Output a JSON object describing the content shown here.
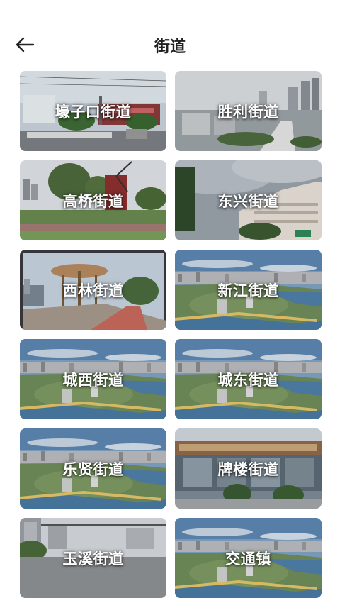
{
  "header": {
    "title": "街道",
    "back_icon": "back-arrow-icon"
  },
  "cards": [
    {
      "label": "壕子口街道",
      "scene": "street"
    },
    {
      "label": "胜利街道",
      "scene": "city"
    },
    {
      "label": "高桥街道",
      "scene": "windmill"
    },
    {
      "label": "东兴街道",
      "scene": "building"
    },
    {
      "label": "西林街道",
      "scene": "plaza"
    },
    {
      "label": "新江街道",
      "scene": "river"
    },
    {
      "label": "城西街道",
      "scene": "river"
    },
    {
      "label": "城东街道",
      "scene": "river"
    },
    {
      "label": "乐贤街道",
      "scene": "river"
    },
    {
      "label": "牌楼街道",
      "scene": "office"
    },
    {
      "label": "玉溪街道",
      "scene": "road"
    },
    {
      "label": "交通镇",
      "scene": "river"
    }
  ]
}
